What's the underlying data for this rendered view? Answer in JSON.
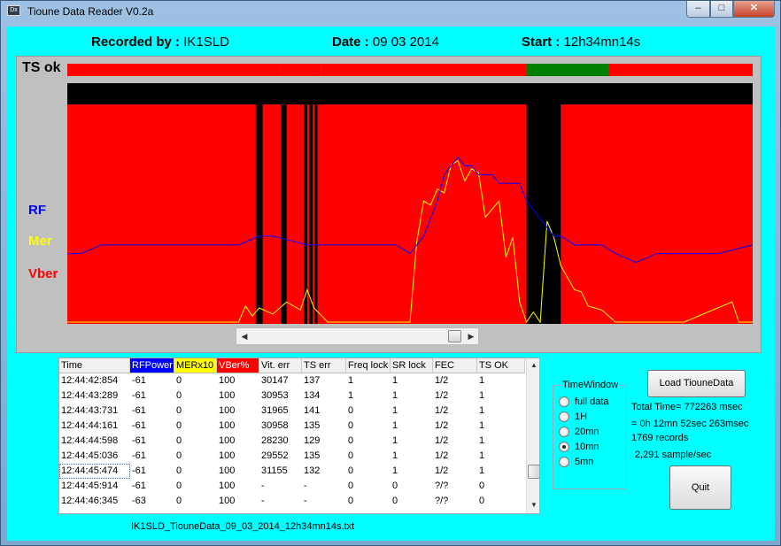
{
  "window": {
    "title": "Tioune Data Reader V0.2a",
    "icon_text": "Dx"
  },
  "header": {
    "recorded_label": "Recorded by :",
    "recorded_value": "IK1SLD",
    "date_label": "Date :",
    "date_value": "09 03 2014",
    "start_label": "Start :",
    "start_value": "12h34mn14s"
  },
  "graph": {
    "ts_label": "TS ok",
    "legend_rf": "RF",
    "legend_mer": "Mer",
    "legend_vber": "Vber",
    "colors": {
      "rf": "#0000ff",
      "mer": "#ffff00",
      "vber": "#ff0000",
      "ts_ok": "#008000"
    }
  },
  "chart_data": {
    "type": "line",
    "title": "",
    "series": [
      {
        "name": "RF",
        "x": [
          0,
          2,
          5,
          8,
          10,
          15,
          20,
          25,
          28,
          30,
          35,
          40,
          45,
          48,
          50,
          51,
          52,
          53,
          54,
          55,
          56,
          57,
          58,
          59,
          60,
          61,
          62,
          63,
          64,
          65,
          66,
          67,
          68,
          69,
          70,
          71,
          72,
          74,
          76,
          78,
          80,
          83,
          86,
          90,
          95,
          100
        ],
        "values": [
          -62,
          -62,
          -61,
          -61,
          -61,
          -61,
          -61,
          -61,
          -60,
          -60,
          -61,
          -61,
          -61,
          -61,
          -62,
          -61,
          -60,
          -58,
          -56,
          -53,
          -52,
          -51,
          -52,
          -52,
          -53,
          -53,
          -53,
          -54,
          -54,
          -54,
          -54,
          -56,
          -57,
          -58,
          -59,
          -60,
          -60,
          -61,
          -61,
          -61,
          -62,
          -63,
          -62,
          -62,
          -62,
          -61
        ]
      },
      {
        "name": "Mer",
        "x": [
          0,
          25,
          26,
          27,
          28,
          30,
          32,
          34,
          35,
          36,
          38,
          40,
          45,
          48,
          50,
          51,
          52,
          53,
          54,
          55,
          56,
          57,
          58,
          59,
          60,
          61,
          62,
          63,
          64,
          65,
          66,
          67,
          68,
          69,
          70,
          71,
          72,
          73,
          74,
          75,
          76,
          78,
          80,
          90,
          97,
          98,
          100
        ],
        "values": [
          0,
          0,
          8,
          3,
          7,
          4,
          10,
          6,
          16,
          7,
          0,
          0,
          0,
          0,
          0,
          40,
          60,
          58,
          66,
          64,
          78,
          80,
          70,
          76,
          74,
          52,
          56,
          60,
          32,
          42,
          10,
          0,
          5,
          0,
          50,
          42,
          28,
          22,
          16,
          15,
          8,
          6,
          0,
          0,
          10,
          0,
          0
        ]
      }
    ],
    "ts_ok_segments": [
      {
        "start": 0,
        "end": 31,
        "value": 0
      },
      {
        "start": 31,
        "end": 37,
        "value": 0
      },
      {
        "start": 37,
        "end": 67,
        "value": 0
      },
      {
        "start": 67,
        "end": 79,
        "value": 1
      },
      {
        "start": 79,
        "end": 100,
        "value": 0
      }
    ],
    "vber_black_regions": [
      {
        "start": 27.5,
        "end": 28.5
      },
      {
        "start": 31.2,
        "end": 32
      },
      {
        "start": 34.5,
        "end": 35
      },
      {
        "start": 35.3,
        "end": 35.8
      },
      {
        "start": 36.1,
        "end": 36.5
      },
      {
        "start": 67,
        "end": 72
      }
    ]
  },
  "table": {
    "columns": [
      "Time",
      "RFPower",
      "MERx10",
      "VBer%",
      "Vit. err",
      "TS err",
      "Freq lock",
      "SR lock",
      "FEC",
      "TS OK"
    ],
    "rows": [
      [
        "12:44:42:854",
        "-61",
        "0",
        "100",
        "30147",
        "137",
        "1",
        "1",
        "1/2",
        "1"
      ],
      [
        "12:44:43:289",
        "-61",
        "0",
        "100",
        "30953",
        "134",
        "1",
        "1",
        "1/2",
        "1"
      ],
      [
        "12:44:43:731",
        "-61",
        "0",
        "100",
        "31965",
        "141",
        "0",
        "1",
        "1/2",
        "1"
      ],
      [
        "12:44:44:161",
        "-61",
        "0",
        "100",
        "30958",
        "135",
        "0",
        "1",
        "1/2",
        "1"
      ],
      [
        "12:44:44:598",
        "-61",
        "0",
        "100",
        "28230",
        "129",
        "0",
        "1",
        "1/2",
        "1"
      ],
      [
        "12:44:45:036",
        "-61",
        "0",
        "100",
        "29552",
        "135",
        "0",
        "1",
        "1/2",
        "1"
      ],
      [
        "12:44:45:474",
        "-61",
        "0",
        "100",
        "31155",
        "132",
        "0",
        "1",
        "1/2",
        "1"
      ],
      [
        "12:44:45:914",
        "-61",
        "0",
        "100",
        "-",
        "-",
        "0",
        "0",
        "?/?",
        "0"
      ],
      [
        "12:44:46:345",
        "-63",
        "0",
        "100",
        "-",
        "-",
        "0",
        "0",
        "?/?",
        "0"
      ]
    ]
  },
  "file": {
    "name": "IK1SLD_TiouneData_09_03_2014_12h34mn14s.txt"
  },
  "timewindow": {
    "label": "TimeWindow",
    "options": [
      "full data",
      "1H",
      "20mn",
      "10mn",
      "5mn"
    ],
    "selected": "10mn"
  },
  "buttons": {
    "load": "Load TiouneData",
    "quit": "Quit"
  },
  "stats": {
    "total_time": "Total Time= 772263 msec",
    "breakdown": "= 0h 12mn 52sec 263msec",
    "records": "1769 records",
    "rate": "2,291 sample/sec"
  }
}
